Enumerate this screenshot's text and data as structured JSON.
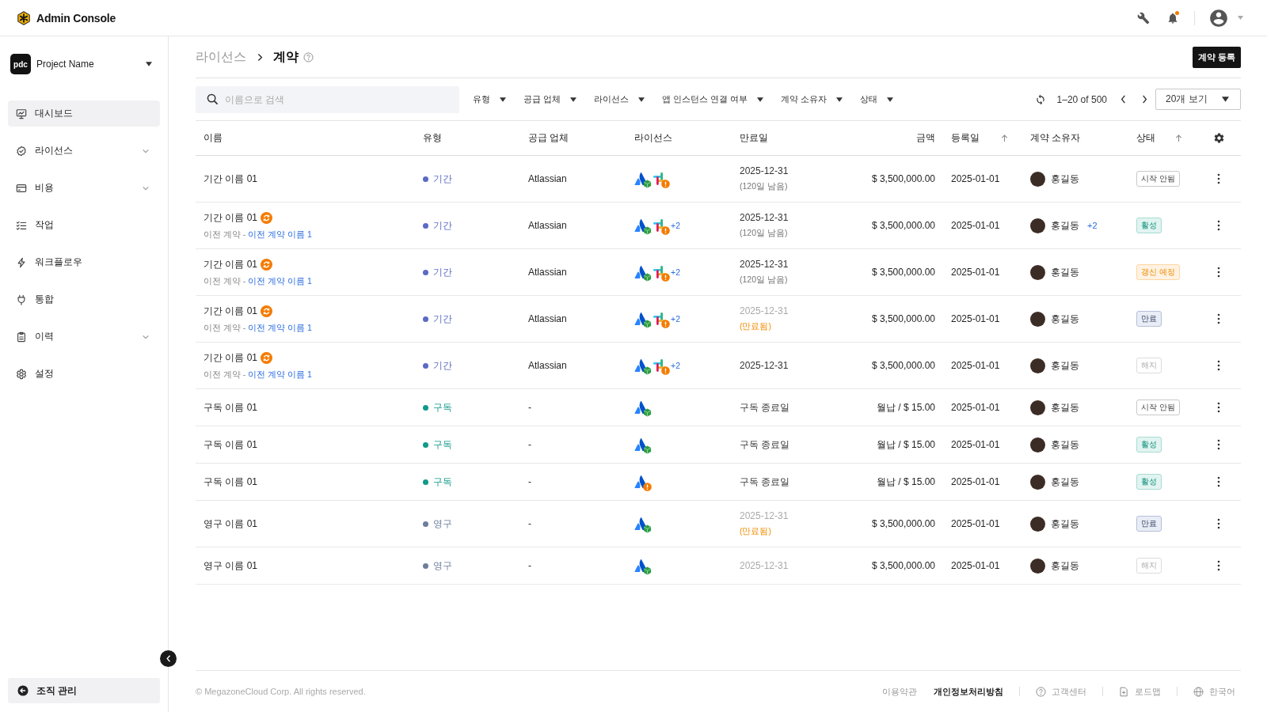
{
  "header": {
    "title": "Admin Console",
    "notification": true
  },
  "sidebar": {
    "project": {
      "logo": "pdc",
      "name": "Project Name"
    },
    "items": [
      {
        "label": "대시보드",
        "selected": true,
        "expandable": false
      },
      {
        "label": "라이선스",
        "selected": false,
        "expandable": true
      },
      {
        "label": "비용",
        "selected": false,
        "expandable": true
      },
      {
        "label": "작업",
        "selected": false,
        "expandable": false
      },
      {
        "label": "워크플로우",
        "selected": false,
        "expandable": false
      },
      {
        "label": "통합",
        "selected": false,
        "expandable": false
      },
      {
        "label": "이력",
        "selected": false,
        "expandable": true
      },
      {
        "label": "설정",
        "selected": false,
        "expandable": false
      }
    ],
    "bottom_item": {
      "label": "조직 관리"
    }
  },
  "page_header": {
    "breadcrumb": [
      "라이선스",
      "계약"
    ],
    "action_button": "계약 등록"
  },
  "toolbar": {
    "search": {
      "placeholder": "이름으로 검색"
    },
    "filters": [
      {
        "label": "유형"
      },
      {
        "label": "공급 업체"
      },
      {
        "label": "라이선스"
      },
      {
        "label": "앱 인스턴스 연결 여부"
      },
      {
        "label": "계약 소유자"
      },
      {
        "label": "상태"
      }
    ],
    "range": "1–20 of 500",
    "page_size": "20개 보기"
  },
  "table": {
    "columns": [
      {
        "label": "이름",
        "sorted": false
      },
      {
        "label": "유형",
        "sorted": false
      },
      {
        "label": "공급 업체",
        "sorted": false
      },
      {
        "label": "라이선스",
        "sorted": false
      },
      {
        "label": "만료일",
        "sorted": false
      },
      {
        "label": "금액",
        "sorted": false
      },
      {
        "label": "등록일",
        "sorted": true
      },
      {
        "label": "계약 소유자",
        "sorted": false
      },
      {
        "label": "상태",
        "sorted": true
      }
    ],
    "rows": [
      {
        "name": "기간 이름 01",
        "renewed": false,
        "type": {
          "label": "기간",
          "color": "#5b6ac4"
        },
        "vendor": "Atlassian",
        "licenses": [
          {
            "kind": "atlassian",
            "warning": false
          },
          {
            "kind": "slack",
            "warning": true
          }
        ],
        "expiry": {
          "date": "2025-12-31",
          "note": "(120일 남음)",
          "expired": false
        },
        "amount": "$ 3,500,000.00",
        "registered": "2025-01-01",
        "owner": {
          "name": "홍길동"
        },
        "status": {
          "label": "시작 안됨",
          "kind": "not_started"
        }
      },
      {
        "name": "기간 이름 01",
        "renewed": true,
        "previous": {
          "label": "이전 계약 -",
          "link": "이전 계약 이름 1"
        },
        "type": {
          "label": "기간",
          "color": "#5b6ac4"
        },
        "vendor": "Atlassian",
        "licenses": [
          {
            "kind": "atlassian",
            "warning": false
          },
          {
            "kind": "slack",
            "warning": true
          }
        ],
        "license_more": "+2",
        "expiry": {
          "date": "2025-12-31",
          "note": "(120일 남음)",
          "expired": false
        },
        "amount": "$ 3,500,000.00",
        "registered": "2025-01-01",
        "owner": {
          "name": "홍길동",
          "more": "+2"
        },
        "status": {
          "label": "활성",
          "kind": "active"
        }
      },
      {
        "name": "기간 이름 01",
        "renewed": true,
        "previous": {
          "label": "이전 계약 -",
          "link": "이전 계약 이름 1"
        },
        "type": {
          "label": "기간",
          "color": "#5b6ac4"
        },
        "vendor": "Atlassian",
        "licenses": [
          {
            "kind": "atlassian",
            "warning": false
          },
          {
            "kind": "slack",
            "warning": true
          }
        ],
        "license_more": "+2",
        "expiry": {
          "date": "2025-12-31",
          "note": "(120일 남음)",
          "expired": false
        },
        "amount": "$ 3,500,000.00",
        "registered": "2025-01-01",
        "owner": {
          "name": "홍길동"
        },
        "status": {
          "label": "갱신 예정",
          "kind": "renewal"
        }
      },
      {
        "name": "기간 이름 01",
        "renewed": true,
        "previous": {
          "label": "이전 계약 -",
          "link": "이전 계약 이름 1"
        },
        "type": {
          "label": "기간",
          "color": "#5b6ac4"
        },
        "vendor": "Atlassian",
        "licenses": [
          {
            "kind": "atlassian",
            "warning": false
          },
          {
            "kind": "slack",
            "warning": true
          }
        ],
        "license_more": "+2",
        "expiry": {
          "date": "2025-12-31",
          "note": "(만료됨)",
          "expired": true
        },
        "amount": "$ 3,500,000.00",
        "registered": "2025-01-01",
        "owner": {
          "name": "홍길동"
        },
        "status": {
          "label": "만료",
          "kind": "expired"
        }
      },
      {
        "name": "기간 이름 01",
        "renewed": true,
        "previous": {
          "label": "이전 계약 -",
          "link": "이전 계약 이름 1"
        },
        "type": {
          "label": "기간",
          "color": "#5b6ac4"
        },
        "vendor": "Atlassian",
        "licenses": [
          {
            "kind": "atlassian",
            "warning": false
          },
          {
            "kind": "slack",
            "warning": true
          }
        ],
        "license_more": "+2",
        "expiry": {
          "date": "2025-12-31",
          "expired": false
        },
        "amount": "$ 3,500,000.00",
        "registered": "2025-01-01",
        "owner": {
          "name": "홍길동"
        },
        "status": {
          "label": "해지",
          "kind": "terminated"
        }
      },
      {
        "name": "구독 이름 01",
        "renewed": false,
        "type": {
          "label": "구독",
          "color": "#12998a"
        },
        "vendor": "-",
        "licenses": [
          {
            "kind": "atlassian",
            "warning": false
          }
        ],
        "expiry": {
          "date": "구독 종료일",
          "expired": false
        },
        "amount": "월납 / $ 15.00",
        "registered": "2025-01-01",
        "owner": {
          "name": "홍길동"
        },
        "status": {
          "label": "시작 안됨",
          "kind": "not_started"
        }
      },
      {
        "name": "구독 이름 01",
        "renewed": false,
        "type": {
          "label": "구독",
          "color": "#12998a"
        },
        "vendor": "-",
        "licenses": [
          {
            "kind": "atlassian",
            "warning": false
          }
        ],
        "expiry": {
          "date": "구독 종료일",
          "expired": false
        },
        "amount": "월납 / $ 15.00",
        "registered": "2025-01-01",
        "owner": {
          "name": "홍길동"
        },
        "status": {
          "label": "활성",
          "kind": "active"
        }
      },
      {
        "name": "구독 이름 01",
        "renewed": false,
        "type": {
          "label": "구독",
          "color": "#12998a"
        },
        "vendor": "-",
        "licenses": [
          {
            "kind": "atlassian",
            "warning": true
          }
        ],
        "expiry": {
          "date": "구독 종료일",
          "expired": false
        },
        "amount": "월납 / $ 15.00",
        "registered": "2025-01-01",
        "owner": {
          "name": "홍길동"
        },
        "status": {
          "label": "활성",
          "kind": "active"
        }
      },
      {
        "name": "영구 이름 01",
        "renewed": false,
        "type": {
          "label": "영구",
          "color": "#6e7d9b"
        },
        "vendor": "-",
        "licenses": [
          {
            "kind": "atlassian",
            "warning": false
          }
        ],
        "expiry": {
          "date": "2025-12-31",
          "note": "(만료됨)",
          "expired": true
        },
        "amount": "$ 3,500,000.00",
        "registered": "2025-01-01",
        "owner": {
          "name": "홍길동"
        },
        "status": {
          "label": "만료",
          "kind": "expired"
        }
      },
      {
        "name": "영구 이름 01",
        "renewed": false,
        "type": {
          "label": "영구",
          "color": "#6e7d9b"
        },
        "vendor": "-",
        "licenses": [
          {
            "kind": "atlassian",
            "warning": false
          }
        ],
        "expiry": {
          "date": "2025-12-31",
          "expired": true
        },
        "amount": "$ 3,500,000.00",
        "registered": "2025-01-01",
        "owner": {
          "name": "홍길동"
        },
        "status": {
          "label": "해지",
          "kind": "terminated"
        }
      }
    ]
  },
  "footer": {
    "copyright": "© MegazoneCloud Corp. All rights reserved.",
    "links": [
      {
        "label": "이용약관",
        "emphasis": false
      },
      {
        "label": "개인정보처리방침",
        "emphasis": true
      },
      {
        "label": "고객센터",
        "emphasis": false
      },
      {
        "label": "로드맵",
        "emphasis": false
      },
      {
        "label": "한국어",
        "emphasis": false
      }
    ]
  }
}
